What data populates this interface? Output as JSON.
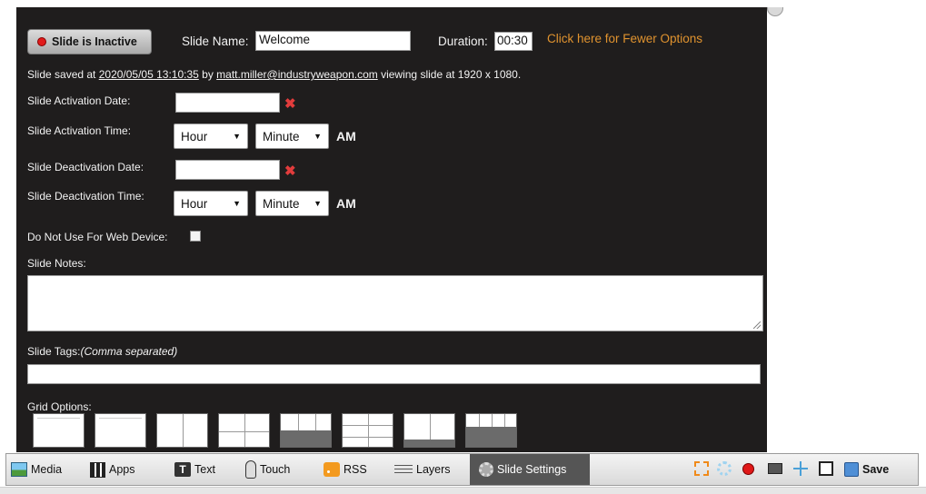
{
  "dialog": {
    "status_button": "Slide is Inactive",
    "slide_name_label": "Slide Name:",
    "slide_name_value": "Welcome",
    "duration_label": "Duration:",
    "duration_value": "00:30",
    "fewer_options_link": "Click here for Fewer Options",
    "saved": {
      "prefix": "Slide saved at ",
      "timestamp": "2020/05/05 13:10:35",
      "by": " by ",
      "user": "matt.miller@industryweapon.com",
      "suffix": " viewing slide at 1920 x 1080."
    },
    "activation_date_label": "Slide Activation Date:",
    "activation_time_label": "Slide Activation Time:",
    "deactivation_date_label": "Slide Deactivation Date:",
    "deactivation_time_label": "Slide Deactivation Time:",
    "hour_option": "Hour",
    "minute_option": "Minute",
    "ampm": "AM",
    "web_device_label": "Do Not Use For Web Device:",
    "notes_label": "Slide Notes:",
    "tags_label": "Slide Tags:",
    "tags_hint": "(Comma separated)",
    "grid_label": "Grid Options:"
  },
  "toolbar": {
    "items": [
      {
        "label": "Media",
        "icon": "image-icon"
      },
      {
        "label": "Apps",
        "icon": "grid-icon"
      },
      {
        "label": "Text",
        "icon": "text-icon"
      },
      {
        "label": "Touch",
        "icon": "touch-hand-icon"
      },
      {
        "label": "RSS",
        "icon": "rss-icon"
      },
      {
        "label": "Layers",
        "icon": "layers-icon"
      },
      {
        "label": "Slide Settings",
        "icon": "gear-icon",
        "active": true
      }
    ],
    "save_label": "Save"
  },
  "colors": {
    "panel_bg": "#1f1d1d",
    "link_orange": "#e0932f",
    "inactive_dot": "#e11b1b",
    "active_tab_bg": "#555555"
  }
}
